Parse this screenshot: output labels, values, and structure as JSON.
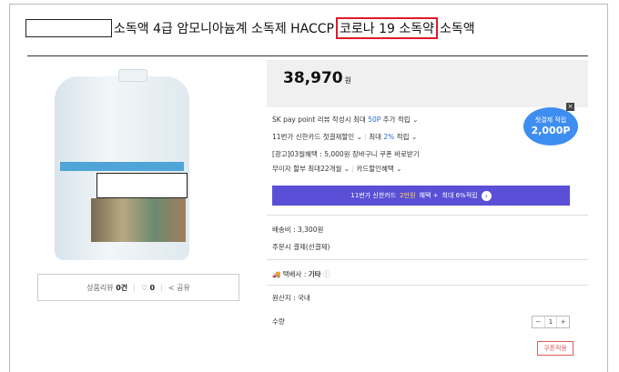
{
  "title": {
    "text_before": "소독액 4급 암모니아늄계 소독제 HACCP",
    "highlight": "코로나 19 소독약",
    "text_after": "소독액"
  },
  "price": {
    "amount": "38,970",
    "unit": "원"
  },
  "benefits": {
    "sk_pay_pre": "SK pay point 리뷰 작성시 최대 ",
    "sk_pay_value": "50P",
    "sk_pay_post": " 추가 적립",
    "card_first": "11번가 신한카드 첫결제할인",
    "max_rate_pre": "최대 ",
    "max_rate": "2%",
    "max_rate_post": " 적립",
    "ad_coupon": "[광고]03월혜택 : 5,000원 장바구니 쿠폰 바로받기",
    "installment": "무이자 할부 최대22개월",
    "card_discount": "카드할인혜택"
  },
  "promo_badge": {
    "line1": "첫결제 적립",
    "line2": "2,000P"
  },
  "card_banner": {
    "pre": "11번가 신한카드 ",
    "amount": "2만원",
    "post": " 혜택 + ",
    "max": "최대 6%적립"
  },
  "shipping": {
    "fee": "배송비 : 3,300원",
    "payment": "주문시 결제(선결제)"
  },
  "courier": {
    "label": "택배사 : ",
    "value": "기타"
  },
  "origin": "원산지 : 국내",
  "quantity": {
    "label": "수량",
    "minus": "−",
    "value": "1",
    "plus": "+"
  },
  "coupon_button": "쿠폰적용",
  "review_bar": {
    "review_label": "상품리뷰",
    "review_count": "0건",
    "like_count": "0",
    "share_label": "공유"
  },
  "colors": {
    "highlight_border": "#e0192b",
    "banner": "#5a4fd6",
    "badge": "#3d8ef0",
    "link_blue": "#2b6ad6"
  }
}
